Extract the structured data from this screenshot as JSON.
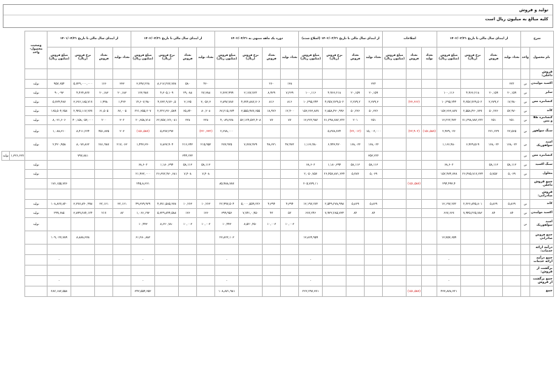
{
  "header": {
    "title": "تولید و فروش",
    "subtitle": "کلیه مبالغ به میلیون ریال است"
  },
  "table": {
    "group_headers": [
      "شرح",
      "از ابتدای سال مالی تا تاریخ ۱۴۰۲/۰۳/۳۱",
      "اصلاحات",
      "از ابتدای سال مالی تا تاریخ ۱۴۰۲/۰۳/۳۱ (اصلاح شده)",
      "دوره یک ماهه منتهی به ۱۴۰۲/۰۴/۳۱",
      "از ابتدای سال مالی تا تاریخ ۱۴۰۲/۰۴/۳۱",
      "از ابتدای سال مالی تا تاریخ ۱۴۰۱/۰۴/۳۱",
      "وضعیت محصول- واحد"
    ],
    "sub_headers": [
      "نام محصول",
      "واحد",
      "تعداد تولید",
      "تعداد فروش",
      "نرخ فروش (ریال)",
      "مبلغ فروش (میلیون ریال)",
      "تعداد تولید",
      "تعداد فروش",
      "مبلغ فروش (میلیون ریال)",
      "تعداد تولید",
      "تعداد فروش",
      "نرخ فروش (ریال)",
      "مبلغ فروش (میلیون ریال)",
      "تعداد تولید",
      "تعداد فروش",
      "نرخ فروش (ریال)",
      "مبلغ فروش (میلیون ریال)",
      "تعداد تولید",
      "تعداد فروش",
      "نرخ فروش (ریال)",
      "مبلغ فروش (میلیون ریال)",
      "تعداد تولید",
      "تعداد فروش",
      "نرخ فروش (ریال)",
      "مبلغ فروش (میلیون ریال)",
      ""
    ],
    "rows": [
      {
        "type": "sec",
        "cells": [
          "فروش داخلی:",
          "",
          "",
          "",
          "",
          "",
          "",
          "",
          "",
          "",
          "",
          "",
          "",
          "",
          "",
          "",
          "",
          "",
          "",
          "",
          "",
          "",
          "",
          "",
          "",
          ""
        ]
      },
      {
        "type": "row",
        "cells": [
          "اکسید مولیبدن",
          "تن",
          "۳۲۲",
          "",
          "",
          "",
          "",
          "",
          "",
          "۳۲۲",
          "",
          "",
          "",
          "۱۳۸",
          "۲۶۰",
          "",
          "",
          "۴۶۰",
          "۵۸۰",
          "۸,۶۱۷,۲۷۷,۷۷۸",
          "۳,۷۹۷,۲۲۸",
          "۳۳۳",
          "۱۶۶",
          "۵,۷۲۹,۰۰۰,۰۰۰",
          "۹۵۷,۶۵۴",
          "تولید"
        ]
      },
      {
        "type": "row",
        "cells": [
          "سایر",
          "تن",
          "۲۰,۱۵۹",
          "۲۰,۱۵۹",
          "۴,۹۶۶,۲۱۸",
          "۱۰۰,۱۱۶",
          "",
          "",
          "",
          "۲۰,۱۵۹",
          "۲۰,۱۵۹",
          "۴,۹۶۶,۲۱۸",
          "۱۰۰,۱۱۶",
          "۷,۲۳۹",
          "۸,۹۲۹",
          "۳,۱۷۷,۷۲۲",
          "۲,۷۳۲,۹۹۹",
          "۲۷,۳۸۸",
          "۲۹,۰۸۸",
          "۴,۳۰۵,۱۰۹",
          "۱۲۳,۹۸۷",
          "۲۰,۱۸۳",
          "۲۰,۱۸۳",
          "۴,۴۶۴,۸۲۷",
          "۹۰,۰۹۳",
          "تولید"
        ]
      },
      {
        "type": "row",
        "cells": [
          "کنسانتره مس",
          "تن",
          "۱۷,۹۸۰",
          "۲,۳۷۹,۲",
          "۴,۲۵۷,۷۲۹,۵۰۲",
          "۱۰,۲۹۵,۲۴۴",
          "",
          "(۲۳,۶۶۶)",
          "",
          "۲,۳۷۹,۳",
          "۲,۲۷۹,۲",
          "۴,۲۵۷,۷۲۹,۵۰۲",
          "۱۰,۲۹۵,۲۴۴",
          "۸۱۶",
          "۸۱۶",
          "۴,۷۷۴,۸۸۷,۷۰۶",
          "۳,۸۹۷,۷۸۷",
          "۳,۰۵۶,۳",
          "۳,۱۳۵",
          "۴,۷۳۲,۹,۷۳۰,۵",
          "۱۴,۶۰۷,۹۸۰",
          "۱,۴۲۳",
          "۱,۹۹۸",
          "۳,۶۷۶,۱۸۵,۷۱۷",
          "۵,۷۳۴,۴۸۷",
          "تولید"
        ]
      },
      {
        "type": "row",
        "cells": [
          "کاتد",
          "تن",
          "۵۲,۹۷۰",
          "۵۰,۲۳۶",
          "۲,۵۵۸,۴۳۰,۷۳۷",
          "۱۵۳,۳۶۳,۸۷۷",
          "",
          "",
          "",
          "۵۰,۳۲۶",
          "۵۰,۲۳۶",
          "۲,۸۵۸,۴۳۰,۹۹۶",
          "۱۵۳,۳۶۳,۸۷۷",
          "۱۲,۴۰۰",
          "۱۸,۹۲۶",
          "۳,۵۵۵,۹۷۷,۶۵۵",
          "۶۷,۲۱۵,۶۷۴",
          "۸۰,۲۰۸",
          "۶۵,۸۴۰",
          "۲,۲۲۲,۳۷۰,۵۸۹",
          "۲۲۱,۳۵۵,۲۰۷",
          "۶۷,۰۰۵",
          "۶۱,۵۰۵",
          "۲,۹۲۵,۱۱۷,۲۷۷",
          "۱۶۵,۵۰۴,۲۵۸",
          "تولید"
        ]
      },
      {
        "type": "row",
        "cells": [
          "کنسانتره طلا و مس",
          "تن",
          "۲۵۱",
          "۲۵۱",
          "۷۱,۲۹۸,۷۸۲,۲۲۲",
          "۱۳,۲۲۲,۴۷۲",
          "",
          "",
          "",
          "۲۵۱",
          "۲۰۱",
          "۷۱,۲۹۸,۷۸۲,۲۲۲",
          "۱۳,۳۲۲,۹۸۲",
          "۷۷",
          "۷۷",
          "۵۳,۱۲۴,۵۲۲,۴۰۸",
          "۴,۰۸۹,۳۷۸",
          "۳۲۸",
          "۳۲۸",
          "۶۲,۷۵۷,۱۲۶,۰۸۱",
          "۲۰,۶۵۸,۷۱۸",
          "۳۰۲",
          "۲۰۰",
          "۴۰,۱۵۸,۰۵۳,۰۰۰",
          "۸,۰۳۱,۶۰۶",
          "تولید"
        ]
      },
      {
        "type": "tall",
        "cells": [
          "سنگ سولفور",
          "تن",
          "۲۲,۵۶۵",
          "۲۲۱,۲۲۹",
          "",
          "۲,۹۳۹,۰۲۶",
          "(۱۵۱,۵۸۷)",
          "(۲۲,۹۰۲)",
          "",
          "۱۵,۰۰۲,۰۰۰",
          "(۲۲,۰۱۲)",
          "۵,۳۷۸,۷۲۴",
          "",
          "",
          "",
          "",
          "۲,۶۷۸,۰۰۰",
          "(۲۲۰,۳۳۲)",
          "",
          "۵,۳۷۷,۲۹۷",
          "(۱۵۱,۵۸۷)",
          "۲۰۳",
          "۴۵۱,۸۳۵",
          "۸,۴۱۱,۲۲۴",
          "۱,۰۸۸,۳۱۰",
          "تولید"
        ]
      },
      {
        "type": "tall",
        "cells": [
          "اسید سولفوریک",
          "تن",
          "۱۶۸,۰۲۲",
          "۱۶۸,۰۲۲",
          "۶,۹۲۹,۵۱۹",
          "۱,۱۶۶,۹۸۰",
          "",
          "",
          "",
          "۱۶۸,۰۲۲",
          "۱۶۸,۰۲۲",
          "۶,۹۴۳,۹۲۰",
          "۱,۱۶۶,۹۸۰",
          "۴۷,۹۳۲",
          "۴۸,۳۲۱",
          "۷,۷۷۷,۹۲۹",
          "۲۷۷,۹۲۵",
          "۲۱۵,۹۵۲",
          "۲۱۶,۳۴۲",
          "۷,۸۳۷,۹۰۴",
          "۱,۴۴۳,۳۳۰",
          "۲۱۷,۰۶۳",
          "۲۸۱,۹۸۷",
          "۸,۰۷۳,۸۶۲",
          "۲,۴۲۰,۹۵۸",
          "تولید"
        ]
      },
      {
        "type": "row",
        "cells": [
          "کنسانتره مس",
          "تن",
          "",
          "",
          "",
          "",
          "",
          "",
          "",
          "۳۵۳,۲۲۲",
          "",
          "",
          "",
          "",
          "",
          "",
          "",
          "",
          "۳۴۴,۲۳۲",
          "",
          "",
          "",
          "",
          "۷۹۷,۸۸۱",
          "",
          "",
          "۱,۳۲۶,۶۲۷",
          "تولید"
        ]
      },
      {
        "type": "row",
        "cells": [
          "سنگ اکسید",
          "تن",
          "۵۸,۱۱۳",
          "۵۸,۱۱۳",
          "",
          "۶۸,۶۰۲",
          "",
          "",
          "",
          "۵۸,۱۱۳",
          "۵۸,۱۱۳",
          "۱,۱۸۰,۳۹۴",
          "۶۸,۶۰۲",
          "",
          "",
          "",
          "",
          "۵۸,۱۱۳",
          "۵۸,۱۱۳",
          "۱,۱۸۰,۳۹۴",
          "۶۸,۶۰۲",
          "",
          "",
          "",
          "",
          "تولید"
        ]
      },
      {
        "type": "row",
        "cells": [
          "محلول",
          "تن",
          "۵,۰۶۹",
          "۵,۷۵۷",
          "۲۶,۴۷۵,۷۱۷,۲۳۴",
          "۱۵۲,۴۷۴,۷۳۸",
          "",
          "",
          "",
          "۵,۰۶۹",
          "۵,۷۷۷",
          "۲۶,۴۵۷,۸۷۱,۲۳۴",
          "۲,۰۵۰,۷۵۷",
          "",
          "",
          "",
          "",
          "۷,۴۰۸",
          "۷,۴۰۸",
          "۲۶,۳۷۲,۴۷۰,۶۸۱",
          "۲۱,۹۳۲,۰۰۰",
          "",
          "",
          "",
          "",
          "تولید"
        ]
      },
      {
        "type": "sec",
        "cells": [
          "جمع فروش داخلی",
          "",
          "",
          "",
          "",
          "۲۹۴,۴۹۳,۴",
          "",
          "(۱۵۱,۵۸۷)",
          "",
          "",
          "",
          "",
          "۲۰۵,۷۷۹,۱۱",
          "",
          "",
          "",
          "۸۵,۹۸۸,۷۸۷",
          "",
          "",
          "",
          "۲۴۵,۸,۳۶۱",
          "",
          "",
          "",
          "۱۷۶,۱۵۵,۷۷۶",
          ""
        ]
      },
      {
        "type": "sec",
        "cells": [
          "فروش صادراتی:",
          "",
          "",
          "",
          "",
          "",
          "",
          "",
          "",
          "",
          "",
          "",
          "",
          "",
          "",
          "",
          "",
          "",
          "",
          "",
          "",
          "",
          "",
          "",
          "",
          ""
        ]
      },
      {
        "type": "row",
        "cells": [
          "کاتد",
          "تن",
          "۵,۸۶۹",
          "۵,۸۶۹",
          "۲,۲۳۶,۸۴۵,۸۰۱",
          "۱۳,۱۹۷,۲۷۲",
          "",
          "",
          "",
          "۵,۸۶۹",
          "۵,۸۶۹",
          "۲,۵۴۹,۲۷۸,۹۹۸",
          "۱۳,۱۹۷,۲۷۲",
          "۴,۳۹۴",
          "۴,۳۹۴",
          "۵,۰۰۰,۵۵۹,۲۲۶",
          "۲۲,۹۹۷,۵۰۴",
          "۱۰,۲۶۳",
          "۱۰,۲۶۳",
          "۴,۷۷۱,۵۸۵,۳۷۸",
          "۴۹,۳۷۹,۹۲۹",
          "۳۲,۱۶۱",
          "۳۲,۱۶۱",
          "۳,۲۷۷,۸۴۰,۹۹۸",
          "۱۰۸,۸۲۷,۸۴۰",
          "تولید"
        ]
      },
      {
        "type": "row",
        "cells": [
          "اکسید مولیبدن",
          "تن",
          "۸۴",
          "۸۴",
          "۷,۹۴۵,۲۲۵,۷۸۳",
          "۶۶۷,۶۶۷",
          "",
          "",
          "",
          "۸۴",
          "۸۴",
          "۷,۹۳۲,۲۸۵,۷۳۴",
          "۶۶۷,۲۴۶",
          "۵۲",
          "۴۲",
          "۷,۷۴۱,۰,۹۵۰",
          "۳۹۹,۹۵۶",
          "۱۳۶",
          "۱۳۶",
          "۵,۳۲۹,۸۴۴,۵۸۸",
          "۱,۰۶۶,۱۹۳",
          "۸۲",
          "۲۱۷",
          "۳,۸۹۹,۲۸۴,۱۲۴",
          "۲۹۹,۶۸۵",
          "تولید"
        ]
      },
      {
        "type": "tall",
        "cells": [
          "اسید سولفوریک",
          "تن",
          "",
          "",
          "",
          "",
          "",
          "",
          "",
          "",
          "",
          "",
          "",
          "۱۰,۰۰۳",
          "۱۰,۰۰۳",
          "۸,۵۲۰,۴۵۰",
          "۱۰,۴۴۳",
          "۱۰,۰۰۳",
          "۱۰,۰۰۳",
          "۸,۶۲۰,۷۸۰",
          "۱۰,۴۴۳",
          "",
          "",
          "",
          "",
          "تولید"
        ]
      },
      {
        "type": "tall",
        "cells": [
          "جمع فروش صادراتی",
          "",
          "",
          "",
          "",
          "۱۳,۷۵۳,۶۵۹",
          "",
          "",
          "",
          "",
          "",
          "",
          "۱۳,۸۶۴,۹۵۹",
          "",
          "",
          "",
          "۲۳,۸۲۲,۱۰۳",
          "",
          "",
          "",
          "۶۱,۲۸۰,۸۸۲",
          "",
          "",
          "۸,۸۸۸,۳۷۸",
          "۱۰۹,۰۲۷,۷۸۹",
          ""
        ]
      },
      {
        "type": "sec",
        "cells": [
          "درآمد ارائه خدمات:",
          "",
          "",
          "",
          "",
          "",
          "",
          "",
          "",
          "",
          "",
          "",
          "",
          "",
          "",
          "",
          "",
          "",
          "",
          "",
          "",
          "",
          "",
          "",
          "",
          ""
        ]
      },
      {
        "type": "sec",
        "cells": [
          "جمع درآمد ارائه خدمات",
          "",
          "",
          "",
          "",
          "-",
          "",
          "",
          "",
          "",
          "",
          "",
          "-",
          "",
          "",
          "",
          "-",
          "",
          "",
          "",
          "-",
          "",
          "",
          "",
          "-",
          ""
        ]
      },
      {
        "type": "sec",
        "cells": [
          "برگشت از فروش:",
          "",
          "",
          "",
          "",
          "",
          "",
          "",
          "",
          "",
          "",
          "",
          "",
          "",
          "",
          "",
          "",
          "",
          "",
          "",
          "",
          "",
          "",
          "",
          "",
          ""
        ]
      },
      {
        "type": "sec",
        "cells": [
          "جمع برگشت از فروش",
          "",
          "",
          "",
          "",
          "-",
          "",
          "",
          "",
          "",
          "",
          "",
          "-",
          "",
          "",
          "",
          "-",
          "",
          "",
          "",
          "-",
          "",
          "",
          "",
          "-",
          ""
        ]
      },
      {
        "type": "sec",
        "cells": [
          "جمع",
          "",
          "",
          "",
          "",
          "۴۳۳,۸۷۸,۳۲۱",
          "",
          "(۱۵۱,۵۸۷)",
          "",
          "",
          "",
          "",
          "۲۲۲,۲۹۷,۳۷۱",
          "",
          "",
          "",
          "۱۰۸,۸۷۱,۹۸۱",
          "",
          "",
          "",
          "۳۴۲,۵۵۴,۳۵۲",
          "",
          "",
          "",
          "۲۸۲,۱۸۲,۵۵۸",
          ""
        ]
      }
    ]
  }
}
